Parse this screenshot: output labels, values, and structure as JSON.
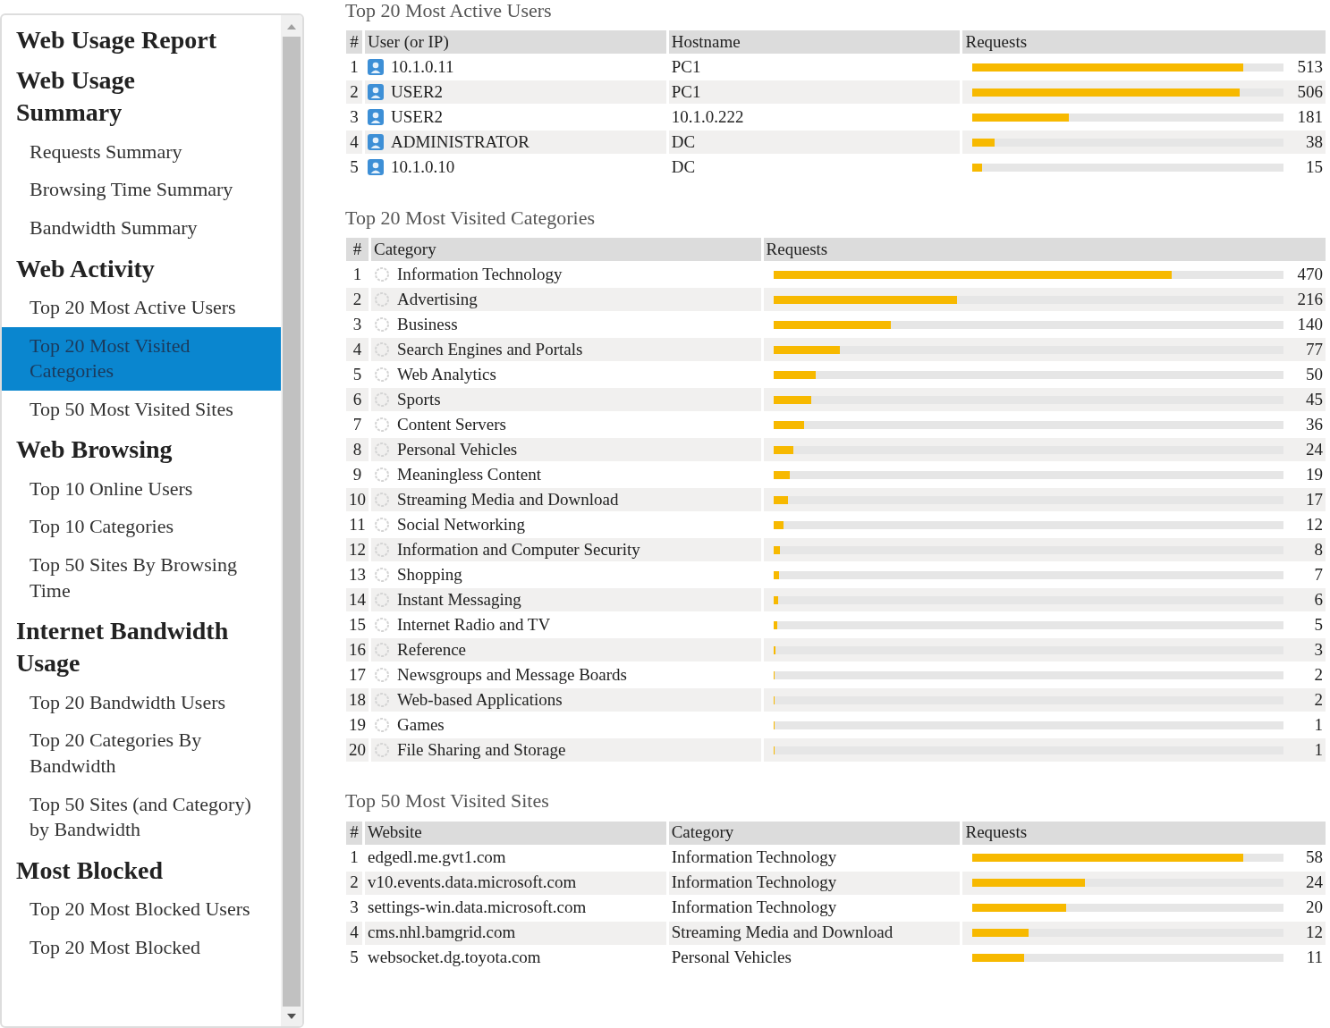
{
  "sidebar": {
    "title": "Web Usage Report",
    "groups": [
      {
        "heading": "Web Usage Summary",
        "items": [
          {
            "label": "Requests Summary",
            "selected": false
          },
          {
            "label": "Browsing Time Summary",
            "selected": false
          },
          {
            "label": "Bandwidth Summary",
            "selected": false
          }
        ]
      },
      {
        "heading": "Web Activity",
        "items": [
          {
            "label": "Top 20 Most Active Users",
            "selected": false
          },
          {
            "label": "Top 20 Most Visited Categories",
            "selected": true
          },
          {
            "label": "Top 50 Most Visited Sites",
            "selected": false
          }
        ]
      },
      {
        "heading": "Web Browsing",
        "items": [
          {
            "label": "Top 10 Online Users",
            "selected": false
          },
          {
            "label": "Top 10 Categories",
            "selected": false
          },
          {
            "label": "Top 50 Sites By Browsing Time",
            "selected": false
          }
        ]
      },
      {
        "heading": "Internet Bandwidth Usage",
        "items": [
          {
            "label": "Top 20 Bandwidth Users",
            "selected": false
          },
          {
            "label": "Top 20 Categories By Bandwidth",
            "selected": false
          },
          {
            "label": "Top 50 Sites (and Category) by Bandwidth",
            "selected": false
          }
        ]
      },
      {
        "heading": "Most Blocked",
        "items": [
          {
            "label": "Top 20 Most Blocked Users",
            "selected": false
          },
          {
            "label": "Top 20 Most Blocked",
            "selected": false
          }
        ]
      }
    ]
  },
  "sections": [
    {
      "title": "Top 20 Most Active Users",
      "columns": [
        {
          "label": "#",
          "kind": "index"
        },
        {
          "label": "User (or IP)",
          "kind": "user"
        },
        {
          "label": "Hostname",
          "kind": "text"
        },
        {
          "label": "Requests",
          "kind": "requests"
        }
      ],
      "rows": [
        {
          "cells": [
            "1",
            "10.1.0.11",
            "PC1"
          ],
          "requests": "513",
          "level": 0.87
        },
        {
          "cells": [
            "2",
            "USER2",
            "PC1"
          ],
          "requests": "506",
          "level": 0.86
        },
        {
          "cells": [
            "3",
            "USER2",
            "10.1.0.222"
          ],
          "requests": "181",
          "level": 0.31
        },
        {
          "cells": [
            "4",
            "ADMINISTRATOR",
            "DC"
          ],
          "requests": "38",
          "level": 0.07
        },
        {
          "cells": [
            "5",
            "10.1.0.10",
            "DC"
          ],
          "requests": "15",
          "level": 0.03
        }
      ]
    },
    {
      "title": "Top 20 Most Visited Categories",
      "columns": [
        {
          "label": "#",
          "kind": "index"
        },
        {
          "label": "Category",
          "kind": "category"
        },
        {
          "label": "Requests",
          "kind": "requests"
        }
      ],
      "rows": [
        {
          "cells": [
            "1",
            "Information Technology"
          ],
          "requests": "470",
          "level": 0.78
        },
        {
          "cells": [
            "2",
            "Advertising"
          ],
          "requests": "216",
          "level": 0.36
        },
        {
          "cells": [
            "3",
            "Business"
          ],
          "requests": "140",
          "level": 0.23
        },
        {
          "cells": [
            "4",
            "Search Engines and Portals"
          ],
          "requests": "77",
          "level": 0.13
        },
        {
          "cells": [
            "5",
            "Web Analytics"
          ],
          "requests": "50",
          "level": 0.083
        },
        {
          "cells": [
            "6",
            "Sports"
          ],
          "requests": "45",
          "level": 0.075
        },
        {
          "cells": [
            "7",
            "Content Servers"
          ],
          "requests": "36",
          "level": 0.06
        },
        {
          "cells": [
            "8",
            "Personal Vehicles"
          ],
          "requests": "24",
          "level": 0.04
        },
        {
          "cells": [
            "9",
            "Meaningless Content"
          ],
          "requests": "19",
          "level": 0.032
        },
        {
          "cells": [
            "10",
            "Streaming Media and Download"
          ],
          "requests": "17",
          "level": 0.028
        },
        {
          "cells": [
            "11",
            "Social Networking"
          ],
          "requests": "12",
          "level": 0.02
        },
        {
          "cells": [
            "12",
            "Information and Computer Security"
          ],
          "requests": "8",
          "level": 0.013
        },
        {
          "cells": [
            "13",
            "Shopping"
          ],
          "requests": "7",
          "level": 0.012
        },
        {
          "cells": [
            "14",
            "Instant Messaging"
          ],
          "requests": "6",
          "level": 0.01
        },
        {
          "cells": [
            "15",
            "Internet Radio and TV"
          ],
          "requests": "5",
          "level": 0.008
        },
        {
          "cells": [
            "16",
            "Reference"
          ],
          "requests": "3",
          "level": 0.005
        },
        {
          "cells": [
            "17",
            "Newsgroups and Message Boards"
          ],
          "requests": "2",
          "level": 0.003
        },
        {
          "cells": [
            "18",
            "Web-based Applications"
          ],
          "requests": "2",
          "level": 0.003
        },
        {
          "cells": [
            "19",
            "Games"
          ],
          "requests": "1",
          "level": 0.002
        },
        {
          "cells": [
            "20",
            "File Sharing and Storage"
          ],
          "requests": "1",
          "level": 0.002
        }
      ]
    },
    {
      "title": "Top 50 Most Visited Sites",
      "columns": [
        {
          "label": "#",
          "kind": "index"
        },
        {
          "label": "Website",
          "kind": "text"
        },
        {
          "label": "Category",
          "kind": "text"
        },
        {
          "label": "Requests",
          "kind": "requests"
        }
      ],
      "rows": [
        {
          "cells": [
            "1",
            "edgedl.me.gvt1.com",
            "Information Technology"
          ],
          "requests": "58",
          "level": 0.87
        },
        {
          "cells": [
            "2",
            "v10.events.data.microsoft.com",
            "Information Technology"
          ],
          "requests": "24",
          "level": 0.36
        },
        {
          "cells": [
            "3",
            "settings-win.data.microsoft.com",
            "Information Technology"
          ],
          "requests": "20",
          "level": 0.3
        },
        {
          "cells": [
            "4",
            "cms.nhl.bamgrid.com",
            "Streaming Media and Download"
          ],
          "requests": "12",
          "level": 0.18
        },
        {
          "cells": [
            "5",
            "websocket.dg.toyota.com",
            "Personal Vehicles"
          ],
          "requests": "11",
          "level": 0.165
        }
      ]
    }
  ]
}
